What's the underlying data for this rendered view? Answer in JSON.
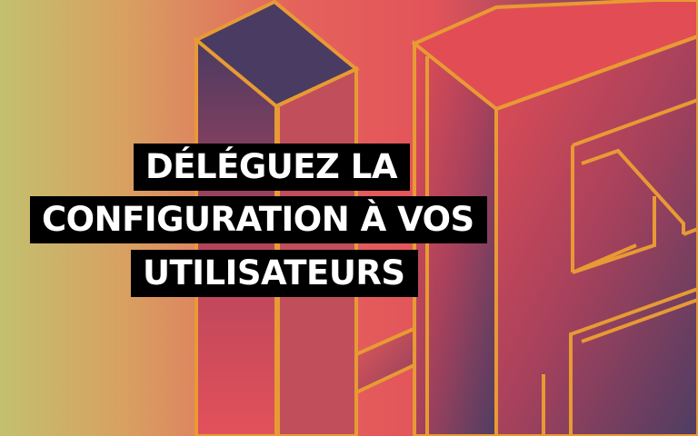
{
  "headline": {
    "lines": [
      "DÉLÉGUEZ LA",
      "CONFIGURATION À VOS",
      "UTILISATEURS"
    ]
  },
  "colors": {
    "gradient_left": "#c2c06e",
    "gradient_mid": "#e2595a",
    "gradient_right": "#4f3f63",
    "outline": "#e89a34",
    "label_background": "#000000",
    "label_text": "#ffffff"
  }
}
